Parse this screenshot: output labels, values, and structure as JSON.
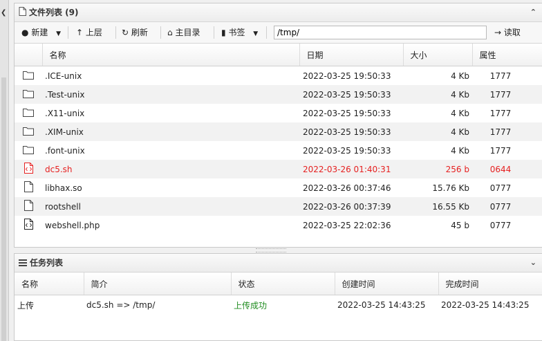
{
  "file_panel": {
    "title": "文件列表 (9)",
    "toolbar": {
      "new_label": "新建",
      "up_label": "上层",
      "refresh_label": "刷新",
      "home_label": "主目录",
      "bookmark_label": "书签",
      "path_value": "/tmp/",
      "read_label": "读取"
    },
    "columns": [
      "名称",
      "日期",
      "大小",
      "属性"
    ],
    "files": [
      {
        "name": ".ICE-unix",
        "date": "2022-03-25 19:50:33",
        "size": "4 Kb",
        "attr": "1777",
        "icon": "folder-icon"
      },
      {
        "name": ".Test-unix",
        "date": "2022-03-25 19:50:33",
        "size": "4 Kb",
        "attr": "1777",
        "icon": "folder-icon"
      },
      {
        "name": ".X11-unix",
        "date": "2022-03-25 19:50:33",
        "size": "4 Kb",
        "attr": "1777",
        "icon": "folder-icon"
      },
      {
        "name": ".XIM-unix",
        "date": "2022-03-25 19:50:33",
        "size": "4 Kb",
        "attr": "1777",
        "icon": "folder-icon"
      },
      {
        "name": ".font-unix",
        "date": "2022-03-25 19:50:33",
        "size": "4 Kb",
        "attr": "1777",
        "icon": "folder-icon"
      },
      {
        "name": "dc5.sh",
        "date": "2022-03-26 01:40:31",
        "size": "256 b",
        "attr": "0644",
        "icon": "code-file-icon"
      },
      {
        "name": "libhax.so",
        "date": "2022-03-26 00:37:46",
        "size": "15.76 Kb",
        "attr": "0777",
        "icon": "file-icon"
      },
      {
        "name": "rootshell",
        "date": "2022-03-26 00:37:39",
        "size": "16.55 Kb",
        "attr": "0777",
        "icon": "file-icon"
      },
      {
        "name": "webshell.php",
        "date": "2022-03-25 22:02:36",
        "size": "45 b",
        "attr": "0777",
        "icon": "code-file-icon"
      }
    ]
  },
  "task_panel": {
    "title": "任务列表",
    "columns": [
      "名称",
      "简介",
      "状态",
      "创建时间",
      "完成时间"
    ],
    "tasks": [
      {
        "name": "上传",
        "desc": "dc5.sh => /tmp/",
        "status": "上传成功",
        "created": "2022-03-25 14:43:25",
        "finished": "2022-03-25 14:43:25"
      }
    ]
  },
  "colors": {
    "highlight_row": "#e62020",
    "success": "#1f8c1f"
  }
}
